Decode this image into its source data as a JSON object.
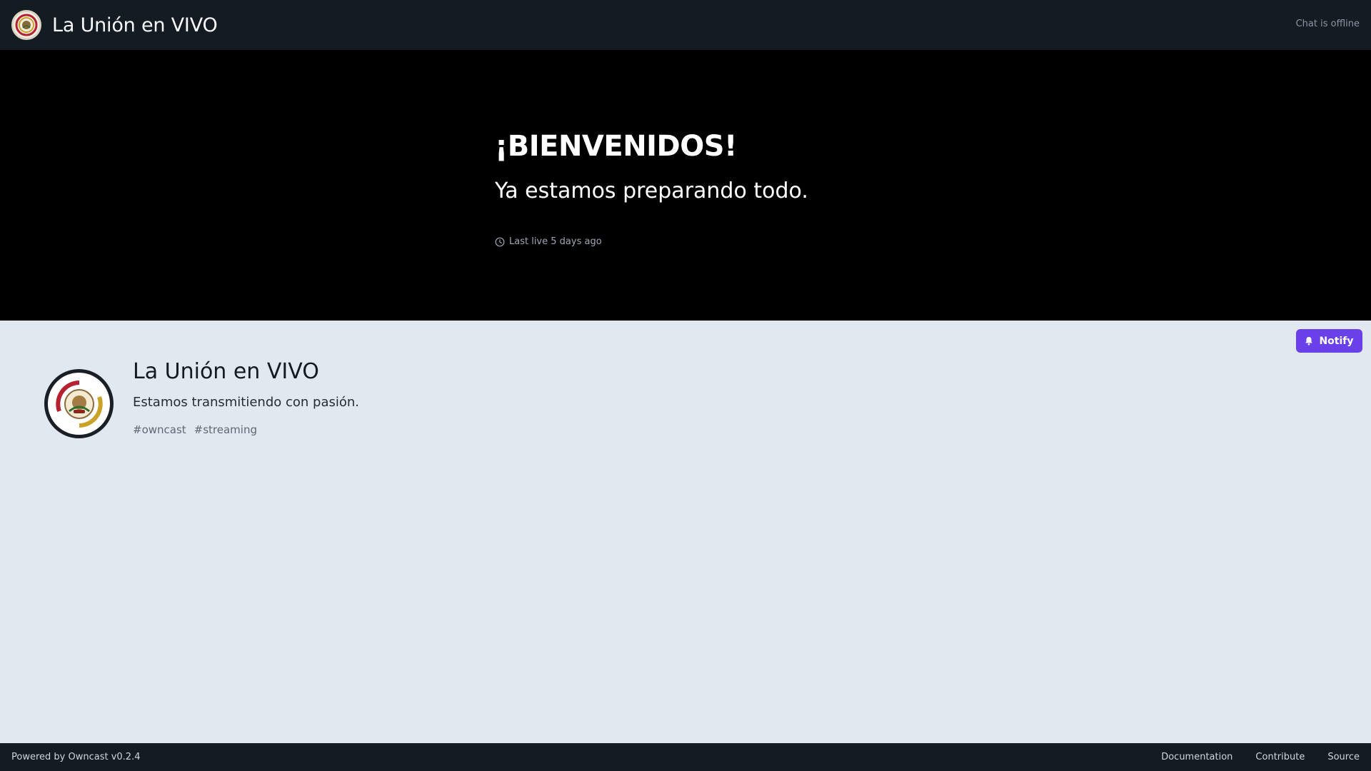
{
  "header": {
    "title": "La Unión en VIVO",
    "chat_status": "Chat is offline",
    "logo_icon": "club-crest-logo"
  },
  "offline_banner": {
    "headline": "¡BIENVENIDOS!",
    "subheadline": "Ya estamos preparando todo.",
    "last_live": "Last live 5 days ago",
    "clock_icon": "clock-icon"
  },
  "notify": {
    "label": "Notify",
    "icon": "bell-icon",
    "color": "#6a41e8"
  },
  "profile": {
    "name": "La Unión en VIVO",
    "description": "Estamos transmitiendo con pasión.",
    "tags": [
      "#owncast",
      "#streaming"
    ]
  },
  "footer": {
    "powered_by": "Powered by Owncast v0.2.4",
    "links": [
      "Documentation",
      "Contribute",
      "Source"
    ]
  },
  "colors": {
    "header_bg": "#151b23",
    "page_bg": "#e2e8f0",
    "banner_bg": "#000000",
    "accent": "#6a41e8"
  }
}
